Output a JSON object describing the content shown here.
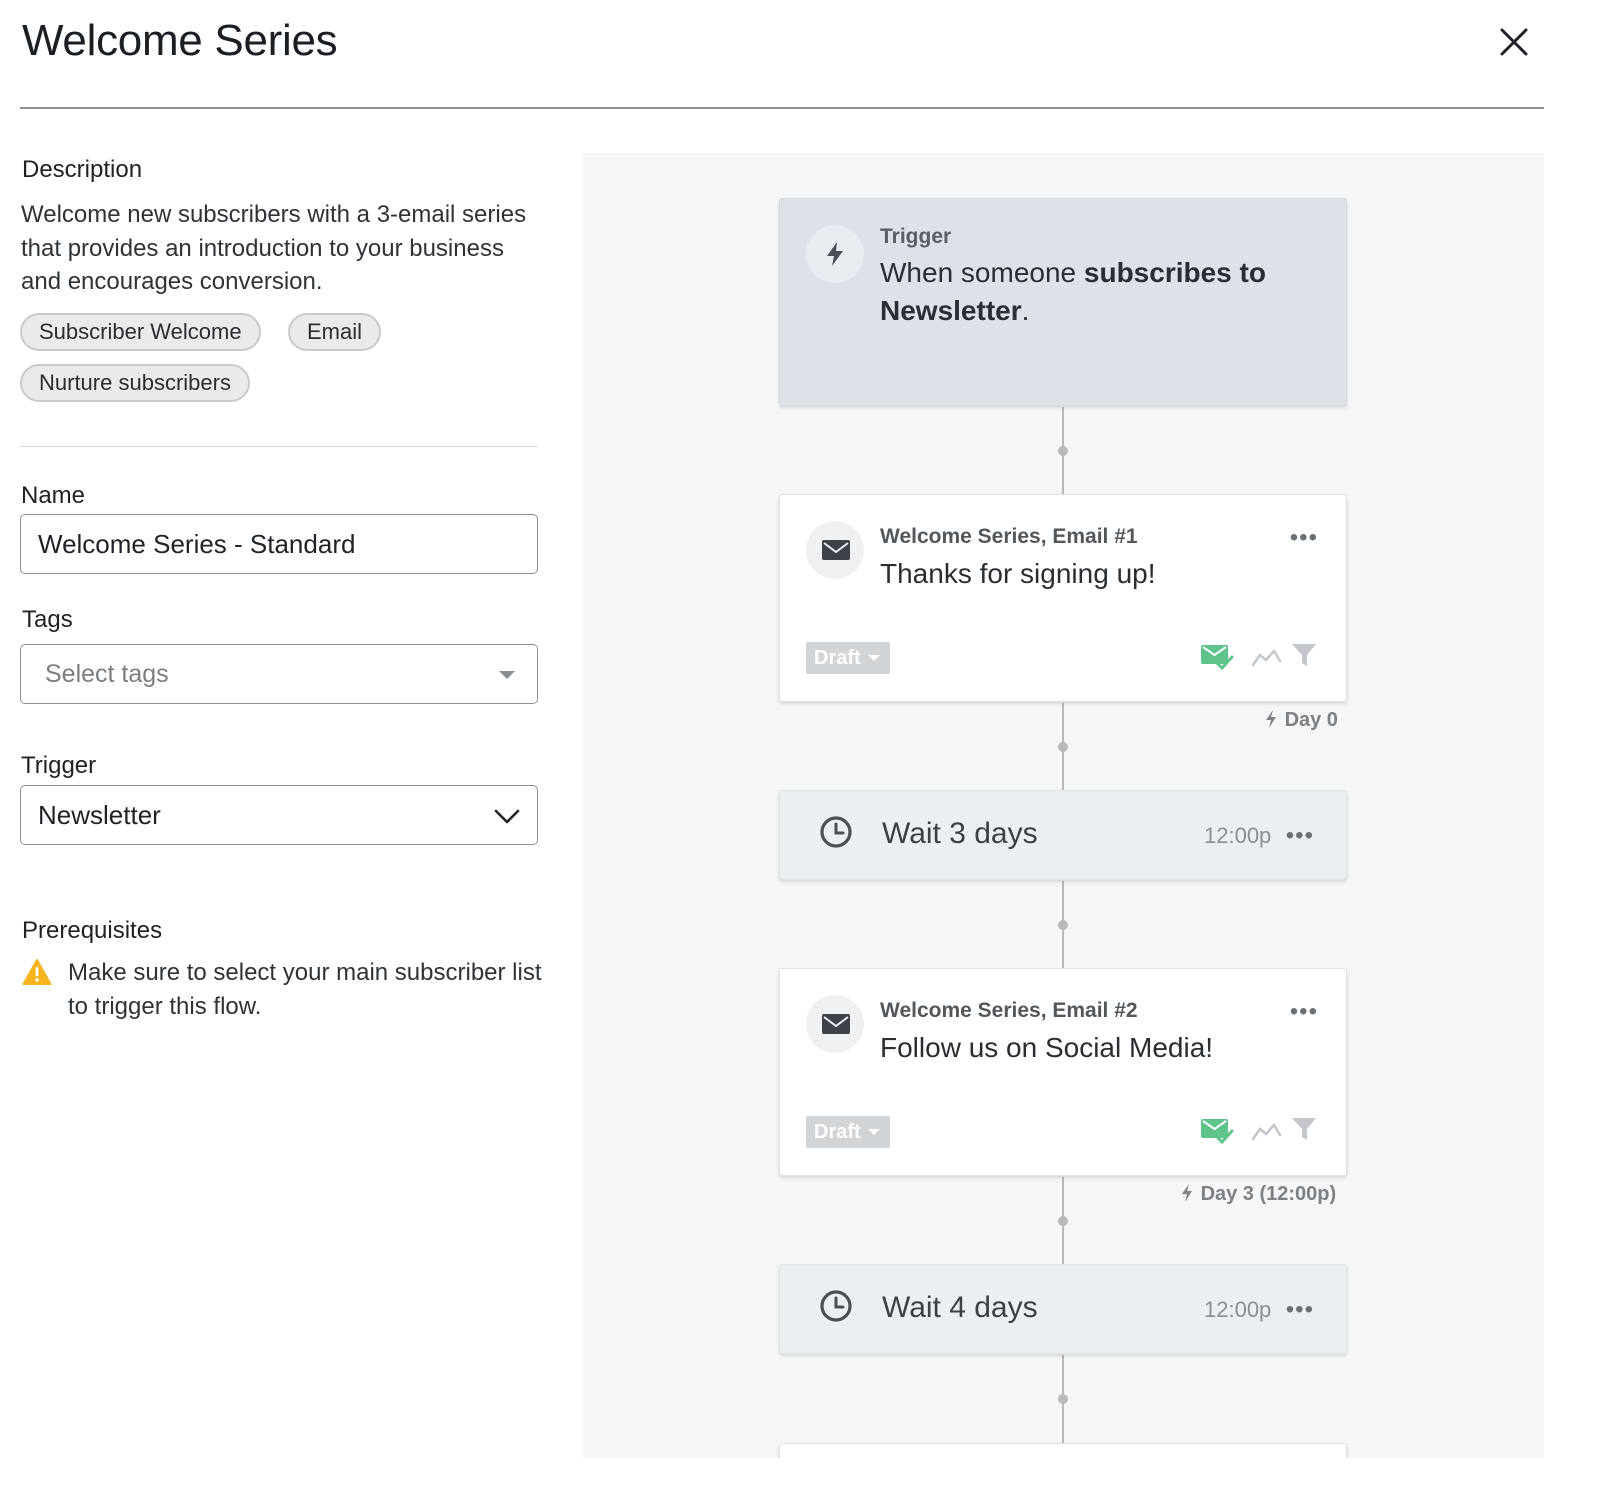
{
  "header": {
    "title": "Welcome Series"
  },
  "description": {
    "label": "Description",
    "text": "Welcome new subscribers with a 3-email series that provides an introduction to your business and encourages conversion.",
    "chips": [
      "Subscriber Welcome",
      "Email",
      "Nurture subscribers"
    ]
  },
  "name": {
    "label": "Name",
    "value": "Welcome Series - Standard"
  },
  "tags": {
    "label": "Tags",
    "placeholder": "Select tags"
  },
  "trigger_field": {
    "label": "Trigger",
    "value": "Newsletter"
  },
  "prerequisites": {
    "label": "Prerequisites",
    "text": "Make sure to select your main subscriber list to trigger this flow."
  },
  "flow": {
    "trigger_card": {
      "eyebrow": "Trigger",
      "prefix": "When someone ",
      "bold1": "subscribes to",
      "bold2": "Newsletter",
      "suffix": "."
    },
    "email1": {
      "eyebrow": "Welcome Series, Email #1",
      "subject": "Thanks for signing up!",
      "status": "Draft",
      "day": "Day 0"
    },
    "wait1": {
      "label": "Wait 3 days",
      "time": "12:00p"
    },
    "email2": {
      "eyebrow": "Welcome Series, Email #2",
      "subject": "Follow us on Social Media!",
      "status": "Draft",
      "day": "Day 3 (12:00p)"
    },
    "wait2": {
      "label": "Wait 4 days",
      "time": "12:00p"
    },
    "more_glyph": "•••"
  },
  "colors": {
    "trigger_card_bg": "#dde2e8",
    "wait_card_bg": "#eaf0f2",
    "canvas_bg": "#f4f6f7",
    "draft_badge": "#d2d5d8",
    "email_ok_green": "#5ec48b",
    "warning_yellow": "#f6b51e"
  },
  "icons": [
    "close-icon",
    "chevron-down-icon",
    "warning-icon",
    "lightning-icon",
    "envelope-icon",
    "clock-icon",
    "envelope-check-icon",
    "trend-icon",
    "filter-icon"
  ]
}
